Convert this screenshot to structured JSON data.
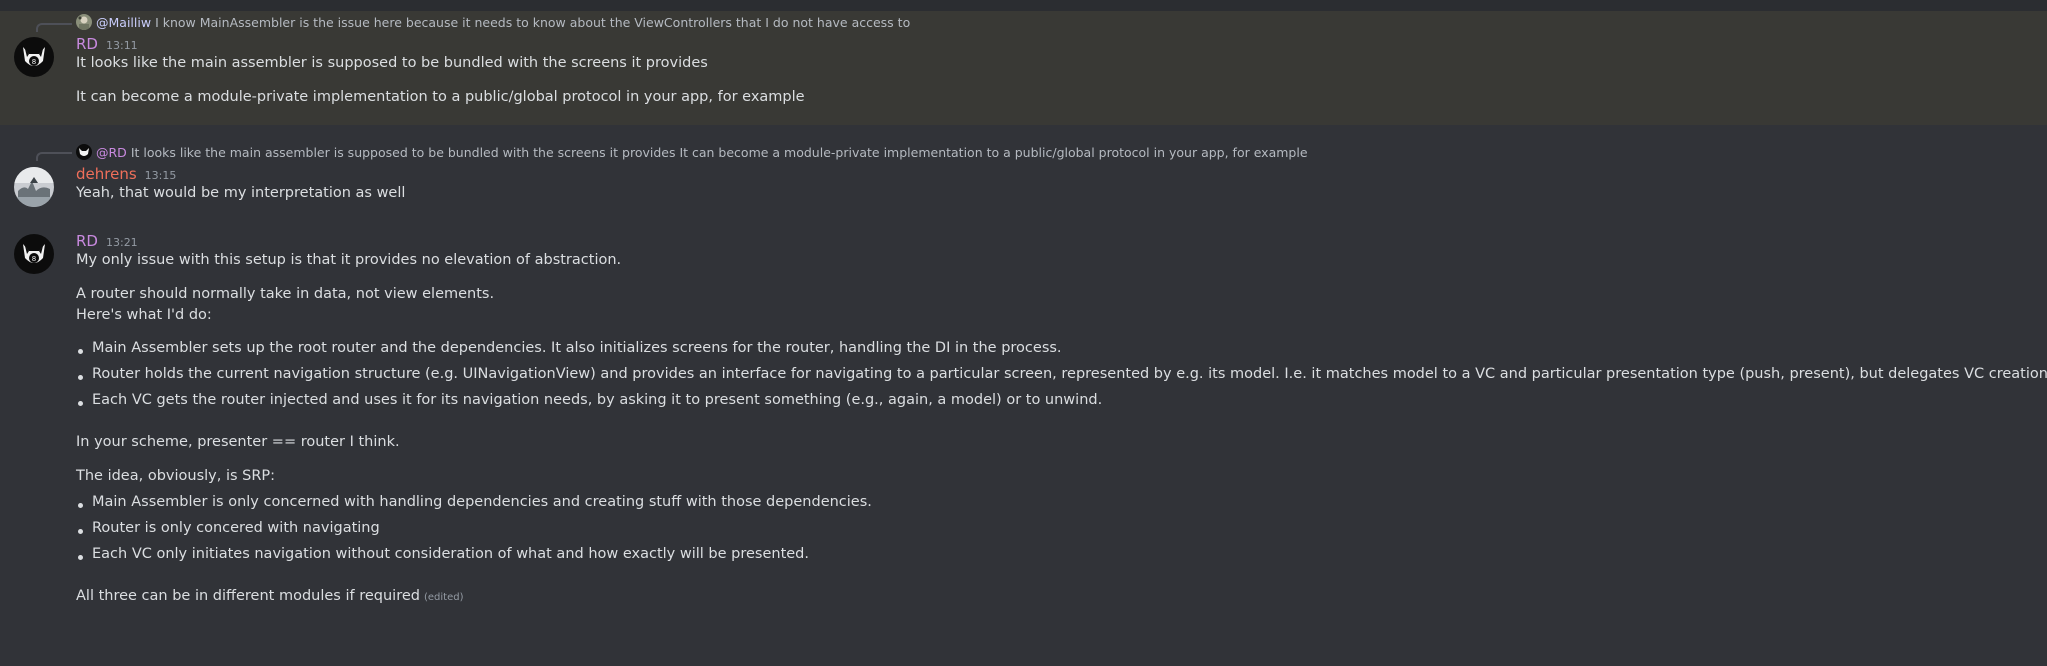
{
  "colors": {
    "background": "#313338",
    "highlight": "#393935",
    "rd_name": "#c98ae0",
    "dehrens_name": "#f06f5a",
    "mention": "#c9cdfb",
    "timestamp": "#949ba4"
  },
  "messages": [
    {
      "author": "RD",
      "time": "13:11",
      "reply": {
        "user": "@Mailliw",
        "text": "I know MainAssembler is the issue here because it needs to know about the ViewControllers that I do not have access to"
      },
      "lines": [
        "It looks like the main assembler is supposed to be bundled with the screens it provides",
        "It can become a module-private implementation to a public/global protocol in your app, for example"
      ]
    },
    {
      "author": "dehrens",
      "time": "13:15",
      "reply": {
        "user": "@RD",
        "text": "It looks like the main assembler is supposed to be bundled with the screens it provides  It can become a module-private implementation to a public/global protocol in your app, for example"
      },
      "lines": [
        "Yeah, that would be my interpretation as well"
      ]
    },
    {
      "author": "RD",
      "time": "13:21",
      "lines": [
        "My only issue with this setup is that it provides no elevation of abstraction.",
        "A router should normally take in data, not view elements.",
        "Here's what I'd do:",
        "In your scheme, presenter == router I think.",
        "The idea, obviously, is SRP:",
        "All three can be in different modules if required"
      ],
      "bullets_a": [
        "Main Assembler sets up the root router and the dependencies. It also initializes screens for the router, handling the DI in the process.",
        "Router holds the current navigation structure (e.g. UINavigationView) and provides an interface for navigating to a particular screen, represented by e.g. its model. I.e. it matches model to a VC and particular presentation type (push, present), but delegates VC creation outside.",
        "Each VC gets the router injected and uses it for its navigation needs, by asking it to present something (e.g., again, a model) or to unwind."
      ],
      "bullets_b": [
        "Main Assembler is only concerned with handling dependencies and creating stuff with those dependencies.",
        "Router is only concered with navigating",
        "Each VC only initiates navigation without consideration of what and how exactly will be presented."
      ],
      "edited_label": "(edited)"
    }
  ]
}
